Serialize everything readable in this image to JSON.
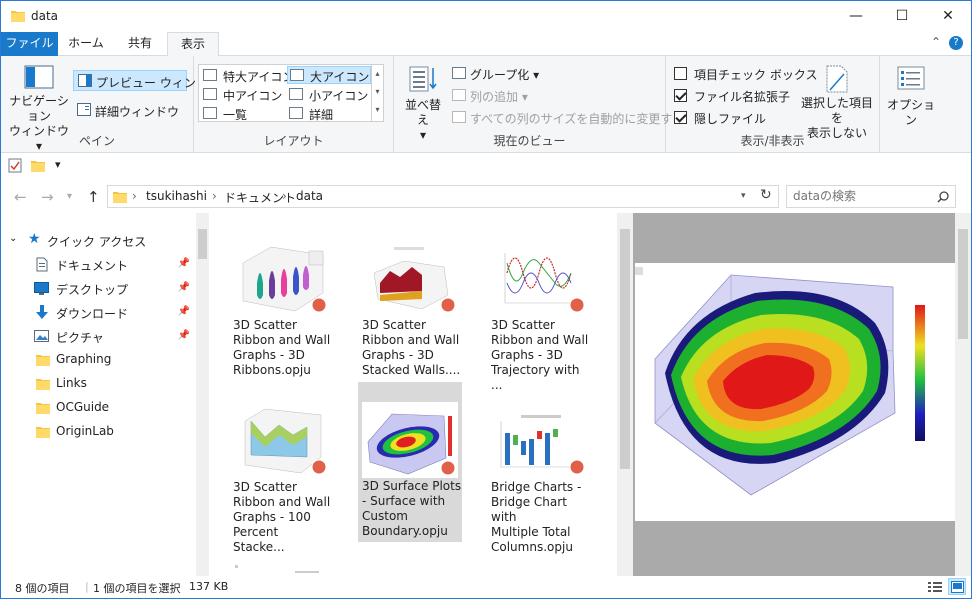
{
  "window": {
    "title": "data",
    "minimize": "—",
    "maximize": "☐",
    "close": "✕"
  },
  "tabs": {
    "file": "ファイル",
    "home": "ホーム",
    "share": "共有",
    "view": "表示",
    "help": "?"
  },
  "ribbon": {
    "pane": {
      "nav_pane_l1": "ナビゲーション",
      "nav_pane_l2": "ウィンドウ",
      "preview": "プレビュー ウィンドウ",
      "details": "詳細ウィンドウ",
      "label": "ペイン"
    },
    "layout": {
      "xl_icons": "特大アイコン",
      "l_icons": "大アイコン",
      "m_icons": "中アイコン",
      "s_icons": "小アイコン",
      "list": "一覧",
      "details": "詳細",
      "label": "レイアウト"
    },
    "view": {
      "sort_l1": "並べ替え",
      "group": "グループ化",
      "add_column": "列の追加",
      "fit_columns": "すべての列のサイズを自動的に変更する",
      "label": "現在のビュー"
    },
    "showhide": {
      "checkboxes": "項目チェック ボックス",
      "extensions": "ファイル名拡張子",
      "hidden": "隠しファイル",
      "hide_sel_l1": "選択した項目を",
      "hide_sel_l2": "表示しない",
      "label": "表示/非表示"
    },
    "options": "オプション"
  },
  "qat": {
    "dropdown": "▾"
  },
  "address": {
    "back": "←",
    "forward": "→",
    "up": "↑",
    "segments": [
      "tsukihashi",
      "ドキュメント",
      "data"
    ],
    "refresh": "↻",
    "search_placeholder": "dataの検索"
  },
  "nav": {
    "quick_access": "クイック アクセス",
    "items": [
      {
        "label": "ドキュメント",
        "pinned": true
      },
      {
        "label": "デスクトップ",
        "pinned": true
      },
      {
        "label": "ダウンロード",
        "pinned": true
      },
      {
        "label": "ピクチャ",
        "pinned": true
      },
      {
        "label": "Graphing",
        "pinned": false
      },
      {
        "label": "Links",
        "pinned": false
      },
      {
        "label": "OCGuide",
        "pinned": false
      },
      {
        "label": "OriginLab",
        "pinned": false
      }
    ]
  },
  "files": [
    {
      "l1": "3D Scatter",
      "l2": "Ribbon and Wall",
      "l3": "Graphs - 3D",
      "l4": "Ribbons.opju"
    },
    {
      "l1": "3D Scatter",
      "l2": "Ribbon and Wall",
      "l3": "Graphs - 3D",
      "l4": "Stacked Walls...."
    },
    {
      "l1": "3D Scatter",
      "l2": "Ribbon and Wall",
      "l3": "Graphs - 3D",
      "l4": "Trajectory with ..."
    },
    {
      "l1": "3D Scatter",
      "l2": "Ribbon and Wall",
      "l3": "Graphs - 100",
      "l4": "Percent Stacke..."
    },
    {
      "l1": "3D Surface Plots",
      "l2": "- Surface with",
      "l3": "Custom",
      "l4": "Boundary.opju"
    },
    {
      "l1": "Bridge Charts -",
      "l2": "Bridge Chart with",
      "l3": "Multiple Total",
      "l4": "Columns.opju"
    }
  ],
  "status": {
    "count": "8 個の項目",
    "selected": "1 個の項目を選択",
    "size": "137 KB"
  },
  "colors": {
    "accent": "#1979ca",
    "selection": "#cce8ff"
  }
}
